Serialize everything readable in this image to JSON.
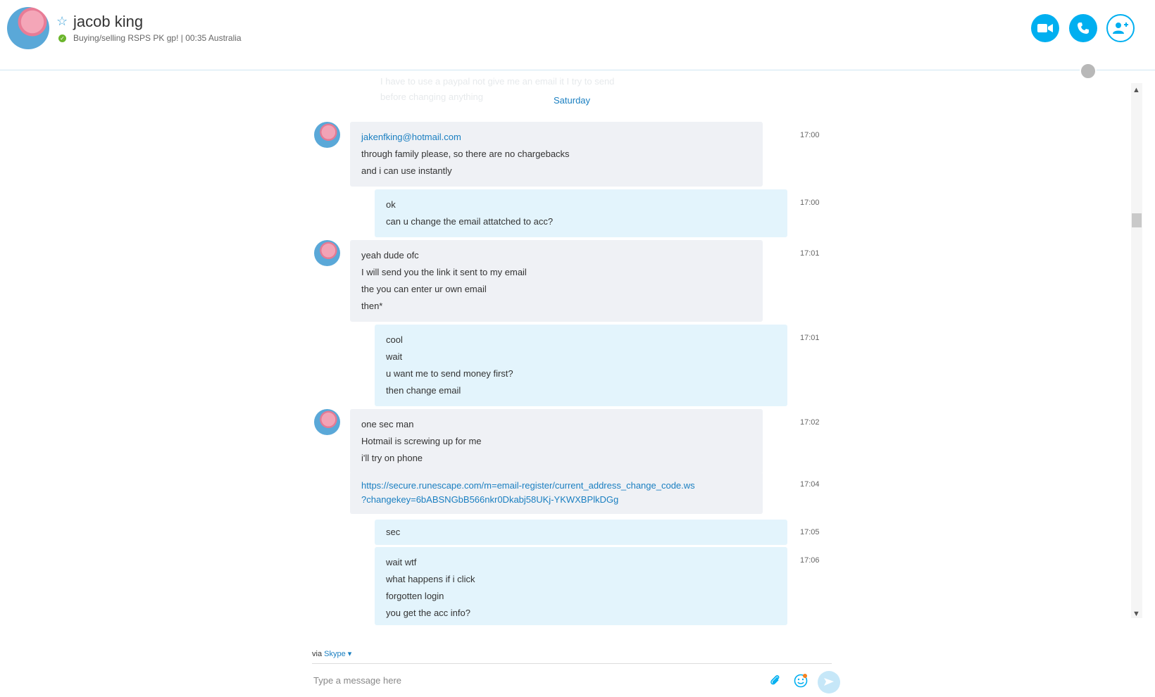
{
  "header": {
    "name": "jacob king",
    "status": "Buying/selling RSPS PK gp!  |  00:35 Australia",
    "colors": {
      "accent": "#00aff0",
      "online": "#6bb52c"
    },
    "icons": [
      "star-icon",
      "video-call-icon",
      "phone-call-icon",
      "add-contact-icon",
      "globe-icon"
    ]
  },
  "conversation": {
    "faded_top": [
      "I have to use a paypal not give me an email it I try to send",
      "before changing anything"
    ],
    "date_separator": "Saturday",
    "messages": [
      {
        "dir": "in",
        "lines": [
          "jakenfking@hotmail.com",
          "through family please, so there are no chargebacks",
          "and i can use instantly"
        ],
        "time": "17:00"
      },
      {
        "dir": "out",
        "lines": [
          "ok",
          "can  u change the email attatched to acc?"
        ],
        "time": "17:00"
      },
      {
        "dir": "in",
        "lines": [
          "yeah dude ofc",
          "I will send you the link it sent to my email",
          "the you can enter ur own email",
          "then*"
        ],
        "time": "17:01"
      },
      {
        "dir": "out",
        "lines": [
          "cool",
          "wait",
          "u want me to send money first?",
          "then change email"
        ],
        "time": "17:01"
      },
      {
        "dir": "in",
        "lines": [
          "one sec man",
          "Hotmail is screwing up for me",
          "i'll try on phone"
        ],
        "time": "17:02"
      },
      {
        "dir": "in",
        "lines": [
          "https://secure.runescape.com/m=email-register/current_address_change_code.ws",
          "?changekey=6bABSNGbB566nkr0Dkabj58UKj-YKWXBPlkDGg"
        ],
        "time": "17:04"
      },
      {
        "dir": "out",
        "lines": [
          "sec"
        ],
        "time": "17:05"
      },
      {
        "dir": "out",
        "lines": [
          "wait wtf",
          "what happens if i click",
          "forgotten login",
          "you get the acc info?"
        ],
        "time": "17:06"
      }
    ]
  },
  "composer": {
    "via_prefix": "via",
    "via_service": "Skype",
    "placeholder": "Type a message here",
    "icons": [
      "attach-icon",
      "emoji-icon",
      "send-icon"
    ]
  }
}
